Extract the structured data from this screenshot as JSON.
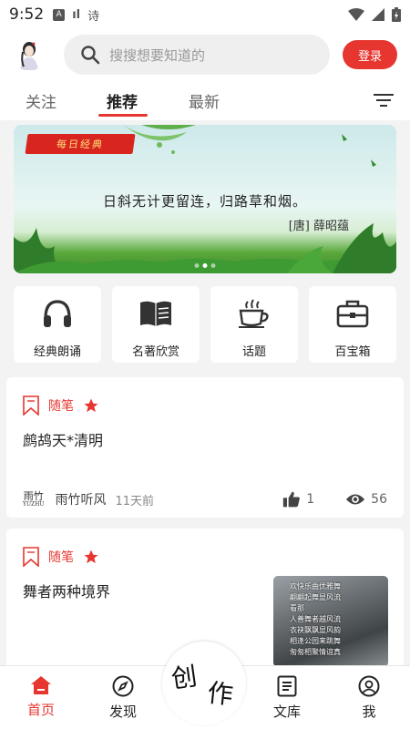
{
  "status": {
    "time": "9:52",
    "note": "诗"
  },
  "search": {
    "placeholder": "搜搜想要知道的"
  },
  "header": {
    "login_label": "登录"
  },
  "tabs": [
    {
      "label": "关注",
      "active": false
    },
    {
      "label": "推荐",
      "active": true
    },
    {
      "label": "最新",
      "active": false
    }
  ],
  "banner": {
    "tag": "每日经典",
    "poem": "日斜无计更留连，归路草和烟。",
    "author": "[唐] 薛昭蕴",
    "slides": 3,
    "current_slide": 1
  },
  "categories": [
    {
      "label": "经典朗诵",
      "icon": "headphones-icon"
    },
    {
      "label": "名著欣赏",
      "icon": "book-icon"
    },
    {
      "label": "话题",
      "icon": "coffee-icon"
    },
    {
      "label": "百宝箱",
      "icon": "toolbox-icon"
    }
  ],
  "posts": [
    {
      "category": "随笔",
      "title": "鹧鸪天*清明",
      "author_logo": "雨竹",
      "author_logo_sub": "YUZHU",
      "author": "雨竹听风",
      "time": "11天前",
      "likes": "1",
      "views": "56"
    },
    {
      "category": "随笔",
      "title": "舞者两种境界",
      "thumb_lines": [
        "欢快乐曲优雅舞",
        "翩翩起舞显风流",
        "看那",
        "人善舞者越风流",
        "衣袂飘飘显风韵",
        "相逢公园来跳舞",
        "匆匆相聚情谊真"
      ]
    }
  ],
  "bottom_nav": [
    {
      "label": "首页",
      "icon": "home-icon",
      "active": true
    },
    {
      "label": "发现",
      "icon": "compass-icon",
      "active": false
    },
    {
      "label": "文库",
      "icon": "library-icon",
      "active": false
    },
    {
      "label": "我",
      "icon": "user-icon",
      "active": false
    }
  ],
  "create": {
    "char1": "创",
    "char2": "作"
  },
  "colors": {
    "accent": "#e6362f",
    "background": "#f3f3f3"
  }
}
